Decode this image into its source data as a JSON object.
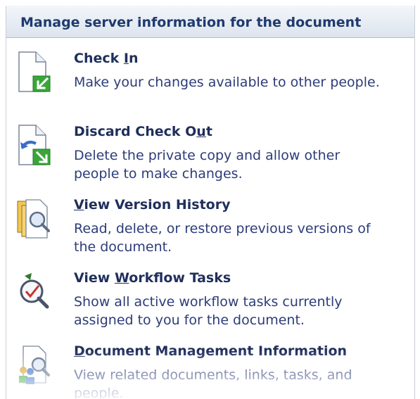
{
  "header": {
    "title": "Manage server information for the document"
  },
  "colors": {
    "header_text": "#1f3a6e",
    "title_text": "#1f2f5c",
    "desc_text": "#2d3c78",
    "accent_green": "#3aa63a"
  },
  "items": [
    {
      "title_pre": "Check ",
      "title_key": "I",
      "title_post": "n",
      "description": "Make your changes available to other people.",
      "icon": "check-in-icon"
    },
    {
      "title_pre": "Discard Check O",
      "title_key": "u",
      "title_post": "t",
      "description": "Delete the private copy and allow other people to make changes.",
      "icon": "discard-check-out-icon"
    },
    {
      "title_pre": "",
      "title_key": "V",
      "title_post": "iew Version History",
      "description": "Read, delete, or restore previous versions of the document.",
      "icon": "version-history-icon"
    },
    {
      "title_pre": "View ",
      "title_key": "W",
      "title_post": "orkflow Tasks",
      "description": "Show all active workflow tasks currently assigned to you for the document.",
      "icon": "workflow-tasks-icon"
    },
    {
      "title_pre": "",
      "title_key": "D",
      "title_post": "ocument Management Information",
      "description": "View related documents, links, tasks, and people.",
      "icon": "document-management-icon"
    }
  ]
}
